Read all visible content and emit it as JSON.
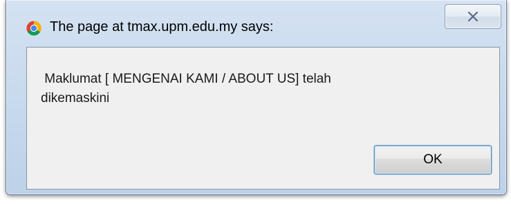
{
  "dialog": {
    "title": "The page at tmax.upm.edu.my says:",
    "app_icon": "chrome-icon",
    "close_icon": "close-icon",
    "message": " Maklumat [ MENGENAI KAMI / ABOUT US] telah\ndikemaskini",
    "ok_label": "OK"
  },
  "colors": {
    "frame": "#c6d8ec",
    "content_background": "#f0f0f0",
    "button_focus_border": "#6c8fb4"
  }
}
